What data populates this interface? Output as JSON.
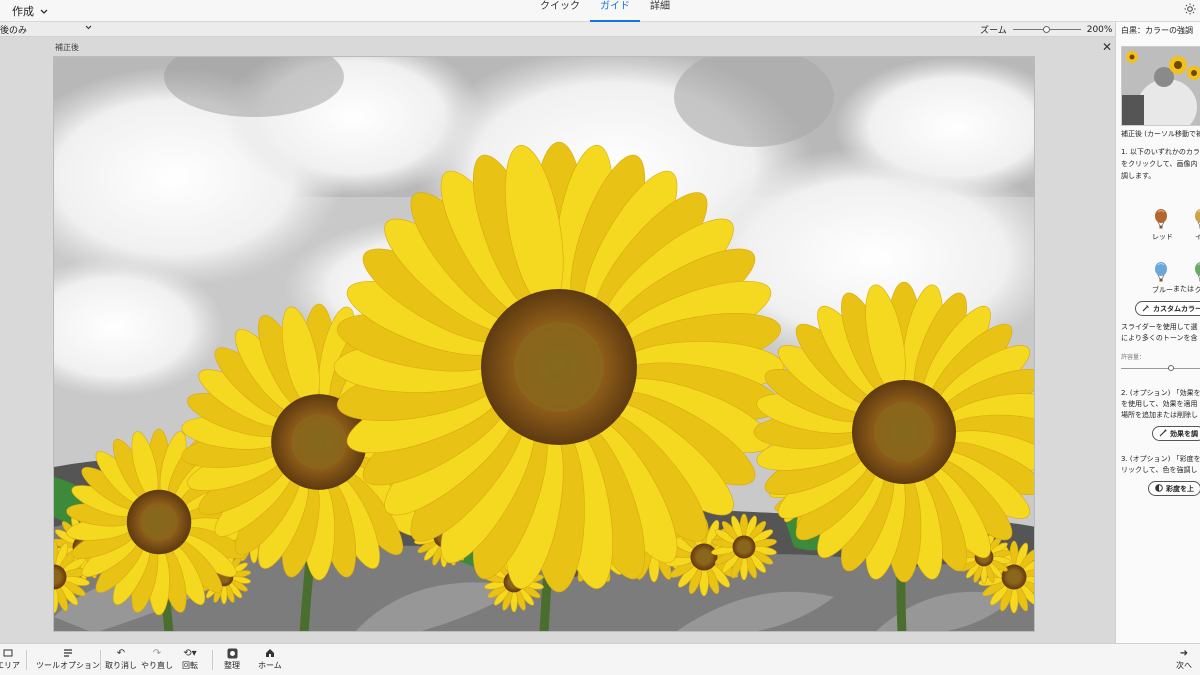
{
  "topbar": {
    "create_label": "作成",
    "tabs": [
      {
        "label": "クイック",
        "active": false
      },
      {
        "label": "ガイド",
        "active": true
      },
      {
        "label": "詳細",
        "active": false
      }
    ]
  },
  "subbar": {
    "view_value": "後のみ",
    "zoom_label": "ズーム",
    "zoom_value": "200%",
    "zoom_fraction": 0.5
  },
  "canvas": {
    "view_title": "補正後"
  },
  "panel": {
    "title": "白黒：カラーの強調",
    "thumb_caption": "補正後 (カーソル移動で補",
    "step1": [
      "1. 以下のいずれかのカラ",
      "をクリックして、画像内",
      "調します。"
    ],
    "colors": [
      {
        "label": "レッド",
        "color": "#b5652e"
      },
      {
        "label": "イ",
        "color": "#caa24a"
      },
      {
        "label": "ブルー",
        "color": "#6aa7d8"
      },
      {
        "label": "グ",
        "color": "#6aa96a"
      }
    ],
    "or_label": "または",
    "custom_color_button": "カスタムカラー",
    "slider_desc": [
      "スライダーを使用して選",
      "により多くのトーンを含"
    ],
    "tolerance_label": "許容量：",
    "tolerance_fraction": 0.55,
    "step2": [
      "2. (オプション) 「効果を",
      "を使用して、効果を適用",
      "場所を追加または削除し"
    ],
    "effect_button": "効果を調",
    "step3": [
      "3. (オプション) 「彩度を",
      "リックして、色を強調し"
    ],
    "saturation_button": "彩度を上"
  },
  "bottombar": {
    "area_label": "エリア",
    "tool_options_label": "ツールオプション",
    "undo_label": "取り消し",
    "redo_label": "やり直し",
    "rotate_label": "回転",
    "organize_label": "整理",
    "home_label": "ホーム",
    "next_label": "次へ"
  },
  "colors": {
    "accent": "#1473e6",
    "sunflower_yellow": "#f2d21a",
    "sunflower_center": "#8a5a18"
  },
  "icons": {
    "create_menu": "chevron-down-icon",
    "sun": "sun-icon",
    "close": "close-icon",
    "eyedropper": "eyedropper-icon",
    "brush": "brush-icon",
    "saturation": "half-circle-icon",
    "undo": "undo-icon",
    "redo": "redo-icon",
    "rotate": "rotate-icon",
    "organize": "organizer-icon",
    "home": "home-icon",
    "next": "arrow-right-icon",
    "tool_options": "tool-options-icon"
  }
}
